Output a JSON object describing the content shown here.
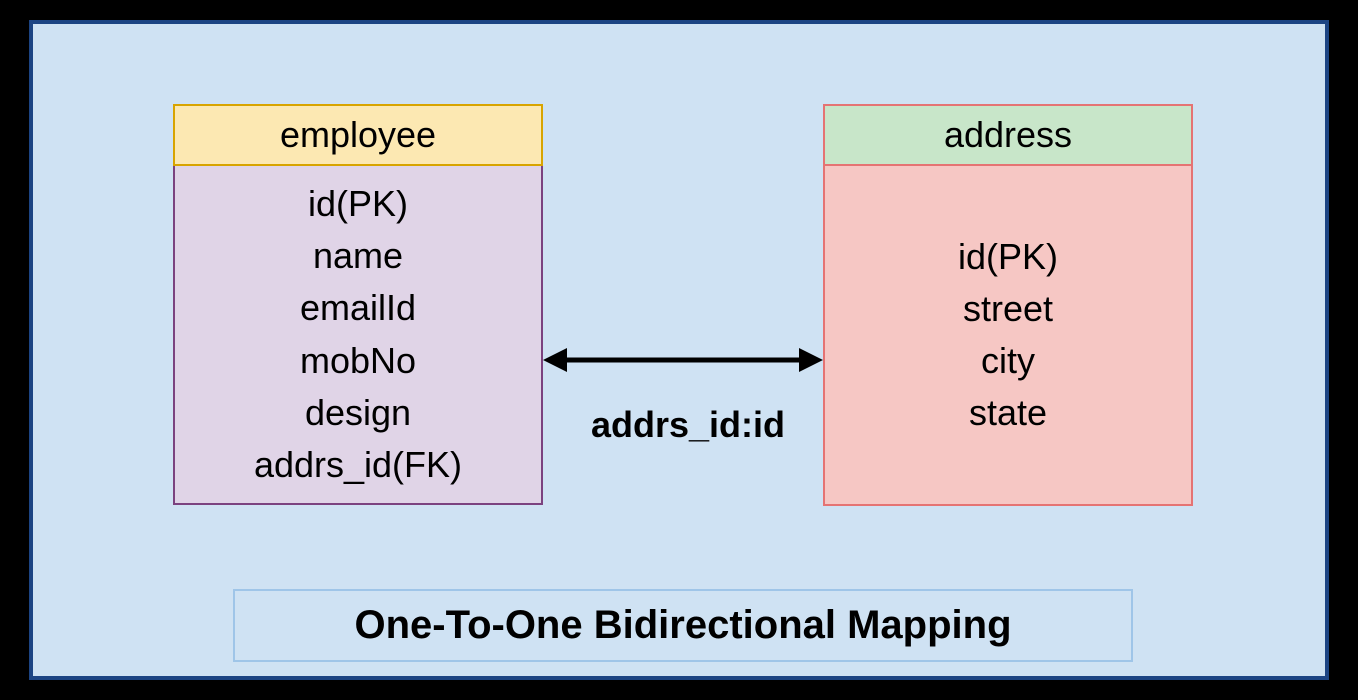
{
  "caption": "One-To-One Bidirectional Mapping",
  "relation_label": "addrs_id:id",
  "entities": {
    "employee": {
      "name": "employee",
      "fields": [
        "id(PK)",
        "name",
        "emailId",
        "mobNo",
        "design",
        "addrs_id(FK)"
      ]
    },
    "address": {
      "name": "address",
      "fields": [
        "id(PK)",
        "street",
        "city",
        "state"
      ]
    }
  },
  "colors": {
    "canvas_bg": "#cfe2f3",
    "canvas_border": "#1c4483",
    "employee_header_bg": "#fce8b2",
    "employee_header_border": "#d8a400",
    "employee_body_bg": "#e0d4e7",
    "employee_body_border": "#7b427f",
    "address_header_bg": "#c8e6c9",
    "address_body_bg": "#f6c7c4",
    "address_border": "#e57373"
  }
}
